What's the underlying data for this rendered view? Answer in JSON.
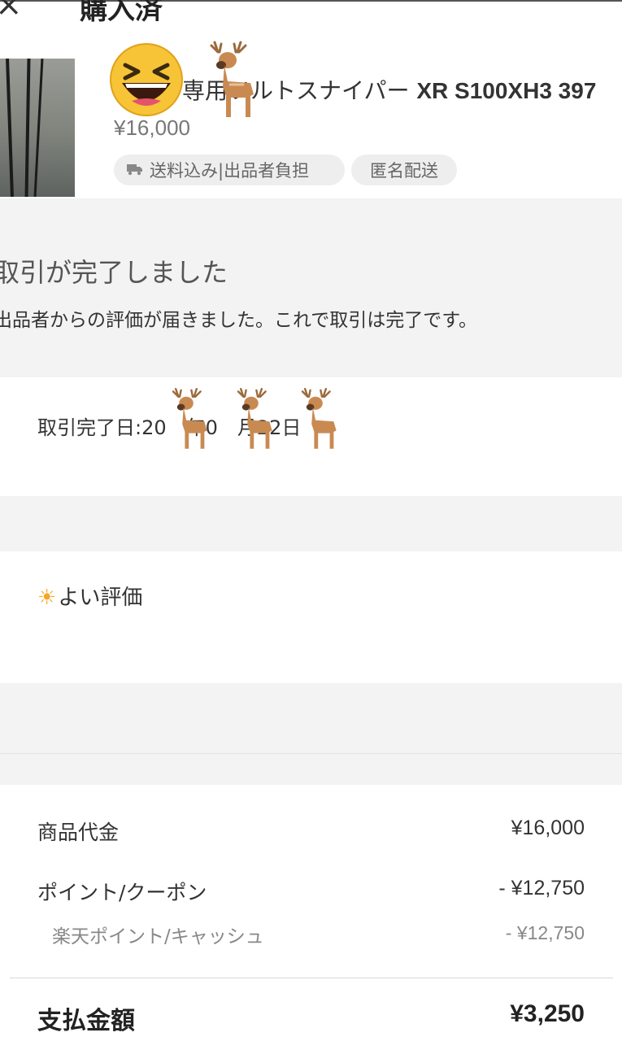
{
  "header": {
    "close_glyph": "×",
    "title": "購入済"
  },
  "product": {
    "name_prefix": "専用",
    "name_mid": "ソルトスナイパー ",
    "name_model": "XR S100XH3 397",
    "price": "¥16,000",
    "tags": {
      "shipping": "送料込み|出品者負担",
      "anonymous": "匿名配送"
    },
    "tag_icon": "truck-icon"
  },
  "completion": {
    "title": "取引が完了しました",
    "message": "出品者からの評価が届きました。これで取引は完了です。",
    "date_label": "取引完了日:20　年0　月22日"
  },
  "rating": {
    "icon": "sun-icon",
    "label": "よい評価"
  },
  "summary": {
    "items": [
      {
        "label": "商品代金",
        "value": "¥16,000"
      },
      {
        "label": "ポイント/クーポン",
        "value": "- ¥12,750"
      },
      {
        "label": "楽天ポイント/キャッシュ",
        "value": "- ¥12,750"
      }
    ],
    "total_label": "支払金額",
    "total_value": "¥3,250"
  },
  "stickers": {
    "emoji_laugh": "😆",
    "emoji_deer": "🦌"
  },
  "colors": {
    "background_gray": "#f3f3f3",
    "text_main": "#333333",
    "text_muted": "#888888",
    "tag_bg": "#eeeeee",
    "sun": "#f5a623"
  }
}
